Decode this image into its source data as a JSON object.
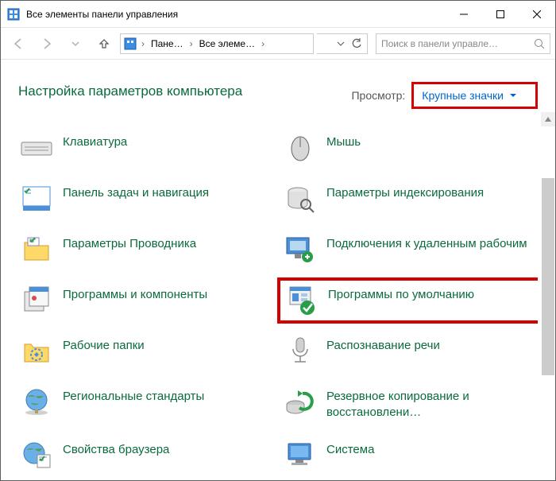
{
  "window": {
    "title": "Все элементы панели управления"
  },
  "breadcrumbs": {
    "root": "Пане…",
    "current": "Все элеме…"
  },
  "search": {
    "placeholder": "Поиск в панели управле…"
  },
  "page": {
    "title": "Настройка параметров компьютера",
    "view_label": "Просмотр:",
    "view_value": "Крупные значки"
  },
  "items": {
    "c0r0": "Клавиатура",
    "c1r0": "Мышь",
    "c0r1": "Панель задач и навигация",
    "c1r1": "Параметры индексирования",
    "c0r2": "Параметры Проводника",
    "c1r2": "Подключения к удаленным рабочим",
    "c0r3": "Программы и компоненты",
    "c1r3": "Программы по умолчанию",
    "c0r4": "Рабочие папки",
    "c1r4": "Распознавание речи",
    "c0r5": "Региональные стандарты",
    "c1r5": "Резервное копирование и восстановлени…",
    "c0r6": "Свойства браузера",
    "c1r6": "Система"
  }
}
